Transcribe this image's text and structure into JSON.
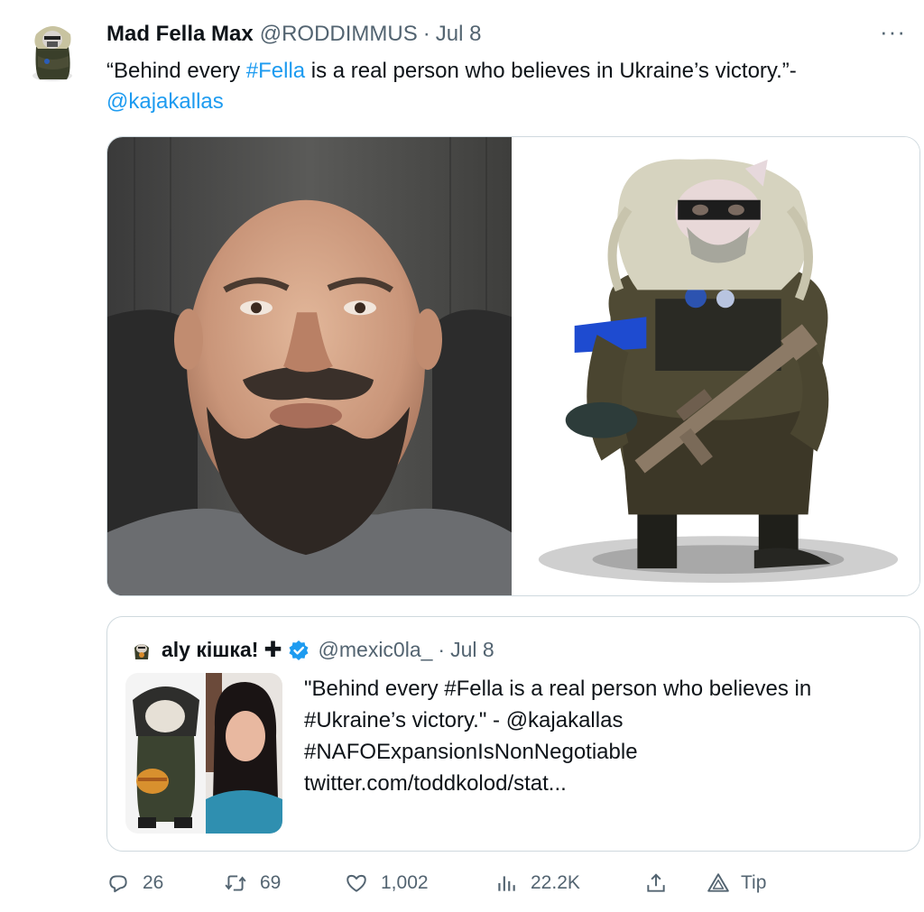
{
  "tweet": {
    "author_name": "Mad Fella Max",
    "author_handle": "@RODDIMMUS",
    "separator": "·",
    "date": "Jul 8",
    "more_label": "···",
    "text_part1": "“Behind every ",
    "hashtag": "#Fella",
    "text_part2": " is a real person who believes in Ukraine’s victory.”-",
    "mention": "@kajakallas"
  },
  "quoted": {
    "author_name": "aly кішка!",
    "plus": "✚",
    "author_handle": "@mexic0la_",
    "separator": "·",
    "date": "Jul 8",
    "line1": "\"Behind every #Fella is a real person who believes in",
    "line2": "#Ukraine’s victory.\" - @kajakallas",
    "line3": "#NAFOExpansionIsNonNegotiable",
    "line4": "twitter.com/toddkolod/stat..."
  },
  "actions": {
    "replies": "26",
    "retweets": "69",
    "likes": "1,002",
    "views": "22.2K",
    "tip_label": "Tip"
  },
  "colors": {
    "link": "#1d9bf0",
    "secondary_text": "#536471",
    "border": "#cfd9de",
    "verified": "#1d9bf0"
  },
  "icons": [
    "reply-icon",
    "retweet-icon",
    "like-icon",
    "views-icon",
    "share-icon",
    "tip-icon",
    "verified-badge-icon",
    "more-icon"
  ]
}
